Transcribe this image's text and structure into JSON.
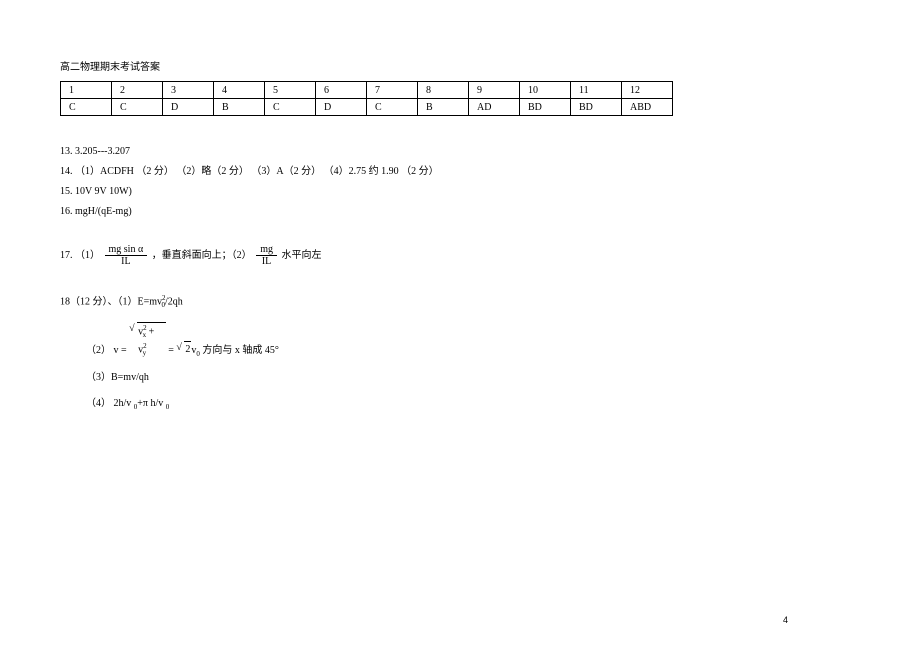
{
  "title": "高二物理期末考试答案",
  "table": {
    "headers": [
      "1",
      "2",
      "3",
      "4",
      "5",
      "6",
      "7",
      "8",
      "9",
      "10",
      "11",
      "12"
    ],
    "answers": [
      "C",
      "C",
      "D",
      "B",
      "C",
      "D",
      "C",
      "B",
      "AD",
      "BD",
      "BD",
      "ABD"
    ]
  },
  "q13": "13. 3.205---3.207",
  "q14": {
    "prefix": "14. （1）ACDFH （2 分） （2）略（2 分） （3）A（2 分）  （4）2.75    约 1.90 （2 分）"
  },
  "q15": "15. 10V  9V   10W)",
  "q16": "16. mgH/(qE-mg)",
  "q17": {
    "label": "17. （1）",
    "frac1_num": "mg sin α",
    "frac1_den": "IL",
    "text1": "，垂直斜面向上；（2）",
    "frac2_num": "mg",
    "frac2_den": "IL",
    "text2": "  水平向左"
  },
  "q18": {
    "header": "18（12 分）、（1）E=mv",
    "header_sup": "2",
    "header_tail": "/2qh",
    "p2_label": "（2） v =",
    "p2_vx": "v",
    "p2_radical_inner1_a": "x",
    "p2_radical_inner1_b": "y",
    "p2_equals": " = ",
    "p2_sqrt2": "2",
    "p2_v0": "v",
    "p2_v0sub": "0",
    "p2_tail": " 方向与  x 轴成  45°",
    "p3": "（3）B=mv/qh",
    "p4_a": "（4） 2h/v ",
    "p4_sub1": "0",
    "p4_mid": "+π h/v",
    "p4_sub2": "0"
  },
  "page_number": "4"
}
